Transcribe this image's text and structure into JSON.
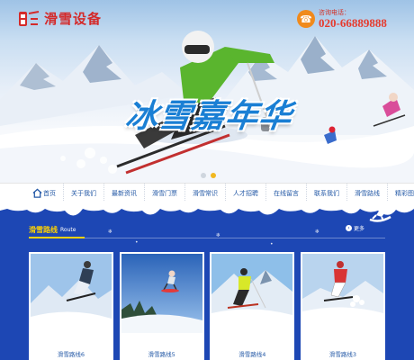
{
  "logo": {
    "text": "滑雪设备",
    "icon": "ski-lift-logo-icon",
    "color": "#d42a2a"
  },
  "hotline": {
    "label": "咨询电话：",
    "number": "020-66889888",
    "icon": "phone-icon"
  },
  "hero": {
    "title": "冰雪嘉年华",
    "slides": 2,
    "active_slide": 2
  },
  "nav": {
    "items": [
      {
        "label": "首页",
        "icon": "home-icon"
      },
      {
        "label": "关于我们"
      },
      {
        "label": "最新资讯"
      },
      {
        "label": "滑雪门票"
      },
      {
        "label": "滑雪常识"
      },
      {
        "label": "人才招聘"
      },
      {
        "label": "在线留言"
      },
      {
        "label": "联系我们"
      },
      {
        "label": "滑雪路线"
      },
      {
        "label": "精彩图片"
      }
    ]
  },
  "section": {
    "title": "滑雪路线",
    "title_en": "Route",
    "more_label": "更多",
    "cards": [
      {
        "caption": "滑雪路线6"
      },
      {
        "caption": "滑雪路线5"
      },
      {
        "caption": "滑雪路线4"
      },
      {
        "caption": "滑雪路线3"
      }
    ]
  },
  "colors": {
    "accent": "#1d47b4",
    "highlight": "#ffd200",
    "title_blue": "#1a7fd4",
    "phone_red": "#e63b2e"
  }
}
